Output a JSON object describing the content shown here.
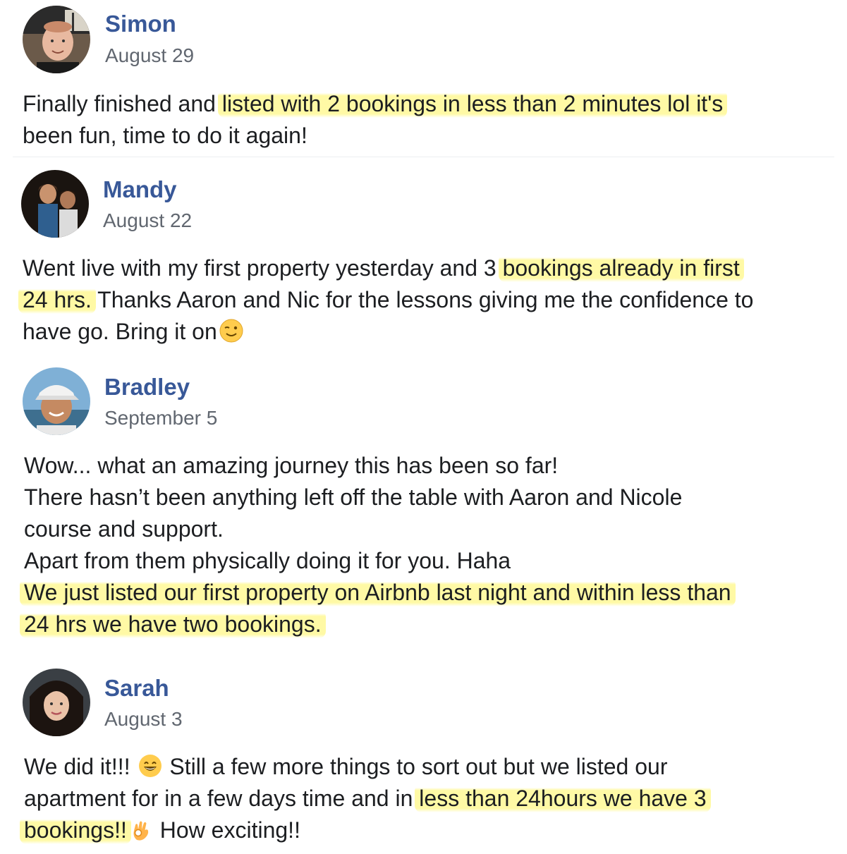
{
  "posts": [
    {
      "name": "Simon",
      "date": "August 29",
      "lines": [
        {
          "pre": "Finally finished and ",
          "hl": "listed with 2 bookings in less than 2 minutes lol it's",
          "post": ""
        },
        {
          "pre": "been fun, time to do it again!",
          "hl": "",
          "post": ""
        }
      ]
    },
    {
      "name": "Mandy",
      "date": "August 22",
      "lines": [
        {
          "pre": "Went live with my first property yesterday and 3 ",
          "hl": "bookings already in first",
          "post": ""
        },
        {
          "pre": "",
          "hl": "24 hrs.",
          "post": " Thanks Aaron and Nic for the lessons giving me the confidence to"
        },
        {
          "pre": "have go. Bring it on",
          "hl": "",
          "post": ""
        }
      ],
      "emoji": "wink-emoji"
    },
    {
      "name": "Bradley",
      "date": "September 5",
      "lines": [
        {
          "pre": "Wow... what an amazing journey this has been so far!",
          "hl": "",
          "post": ""
        },
        {
          "pre": "There hasn’t been anything left off the table with Aaron and Nicole",
          "hl": "",
          "post": ""
        },
        {
          "pre": "course and support.",
          "hl": "",
          "post": ""
        },
        {
          "pre": "Apart from them physically doing it for you. Haha",
          "hl": "",
          "post": ""
        },
        {
          "pre": "",
          "hl": "We just listed our first property on Airbnb last night and within less than",
          "post": ""
        },
        {
          "pre": "",
          "hl": "24 hrs we have two bookings.",
          "post": ""
        }
      ]
    },
    {
      "name": "Sarah",
      "date": "August 3",
      "lines": [
        {
          "pre": "We did it!!! ",
          "hl": "",
          "post": " Still a few more things to sort out but we listed our"
        },
        {
          "pre": "apartment for in a few days time and in ",
          "hl": "less than 24hours we have 3",
          "post": ""
        },
        {
          "pre": "",
          "hl": "bookings!!",
          "post": " How exciting!!"
        }
      ],
      "emojis": [
        "grin-emoji",
        "ok-hand-emoji"
      ]
    }
  ],
  "colors": {
    "name": "#385898",
    "date": "#616770",
    "text": "#1c1e21",
    "highlight": "#fff9a0"
  }
}
